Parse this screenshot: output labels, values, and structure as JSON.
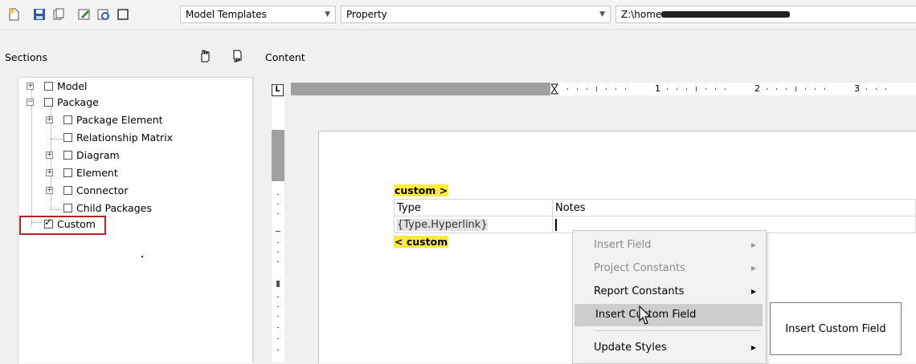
{
  "toolbar": {
    "template_combo": "Model Templates",
    "property_combo": "Property",
    "path_prefix": "Z:\\home",
    "icons": [
      "new-icon",
      "save-icon",
      "copy-icon",
      "edit-icon",
      "preview-icon",
      "layout-icon"
    ]
  },
  "sections": {
    "title": "Sections",
    "move_up_icon": "hand-up-icon",
    "move_down_icon": "hand-down-icon",
    "tree": [
      {
        "label": "Model",
        "checked": false,
        "expander": "+"
      },
      {
        "label": "Package",
        "checked": false,
        "expander": "-"
      },
      {
        "label": "Package Element",
        "checked": false,
        "expander": "+"
      },
      {
        "label": "Relationship Matrix",
        "checked": false,
        "expander": ""
      },
      {
        "label": "Diagram",
        "checked": false,
        "expander": "+"
      },
      {
        "label": "Element",
        "checked": false,
        "expander": "+"
      },
      {
        "label": "Connector",
        "checked": false,
        "expander": "+"
      },
      {
        "label": "Child Packages",
        "checked": false,
        "expander": ""
      },
      {
        "label": "Custom",
        "checked": true,
        "expander": ""
      }
    ],
    "highlight_color": "#b22222"
  },
  "content": {
    "title": "Content",
    "ruler_marks": [
      "1",
      "2",
      "3"
    ],
    "custom_open": "custom >",
    "custom_close": "< custom",
    "table": {
      "headers": [
        "Type",
        "Notes"
      ],
      "rows": [
        [
          "{Type.Hyperlink}",
          ""
        ]
      ]
    }
  },
  "context_menu": {
    "items": [
      {
        "label": "Insert Field",
        "enabled": false,
        "submenu": true
      },
      {
        "label": "Project Constants",
        "enabled": false,
        "submenu": true
      },
      {
        "label": "Report Constants",
        "enabled": true,
        "submenu": true
      },
      {
        "label": "Insert Custom Field",
        "enabled": true,
        "submenu": false,
        "hovered": true
      },
      {
        "label": "Update Styles",
        "enabled": true,
        "submenu": true
      }
    ]
  },
  "tooltip": {
    "text": "Insert Custom Field"
  }
}
